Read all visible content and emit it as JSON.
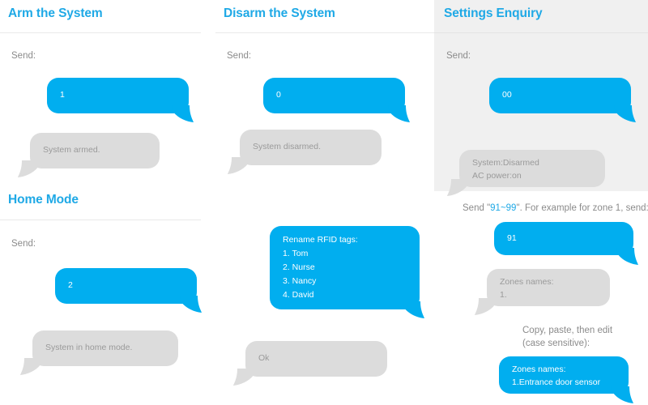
{
  "colors": {
    "accent_blue": "#1fa9e6",
    "bubble_blue": "#01aeef",
    "bubble_gray": "#dcdcdc",
    "panel_gray": "#f0f0f0",
    "label_gray": "#8b8b8b",
    "bubble_gray_text": "#9a9a9a",
    "rule_gray": "#e9e9e9"
  },
  "sections": {
    "arm": {
      "title": "Arm the System",
      "send_label": "Send:",
      "sent_message": "1",
      "reply_message": "System armed."
    },
    "disarm": {
      "title": "Disarm the System",
      "send_label": "Send:",
      "sent_message": "0",
      "reply_message": "System disarmed."
    },
    "settings": {
      "title": "Settings Enquiry",
      "send_label": "Send:",
      "sent_message": "00",
      "reply_line1": "System:Disarmed",
      "reply_line2": "AC power:on"
    },
    "home": {
      "title": "Home Mode",
      "send_label": "Send:",
      "sent_message": "2",
      "reply_message": "System in home mode."
    },
    "rfid": {
      "sent_line1": "Rename RFID tags:",
      "sent_line2": "1. Tom",
      "sent_line3": "2. Nurse",
      "sent_line4": "3. Nancy",
      "sent_line5": "4. David",
      "reply_message": "Ok"
    },
    "zones": {
      "instruction_pre": "Send ",
      "instruction_quote_open": "\"",
      "instruction_highlight": "91~99",
      "instruction_quote_close": "\"",
      "instruction_post": ". For example for zone 1, send:",
      "sent_message": "91",
      "reply_line1": "Zones names:",
      "reply_line2": "1.",
      "edit_note_line1": "Copy, paste, then edit",
      "edit_note_line2": "(case sensitive):",
      "edited_line1": "Zones names:",
      "edited_line2": "1.Entrance door sensor"
    }
  }
}
